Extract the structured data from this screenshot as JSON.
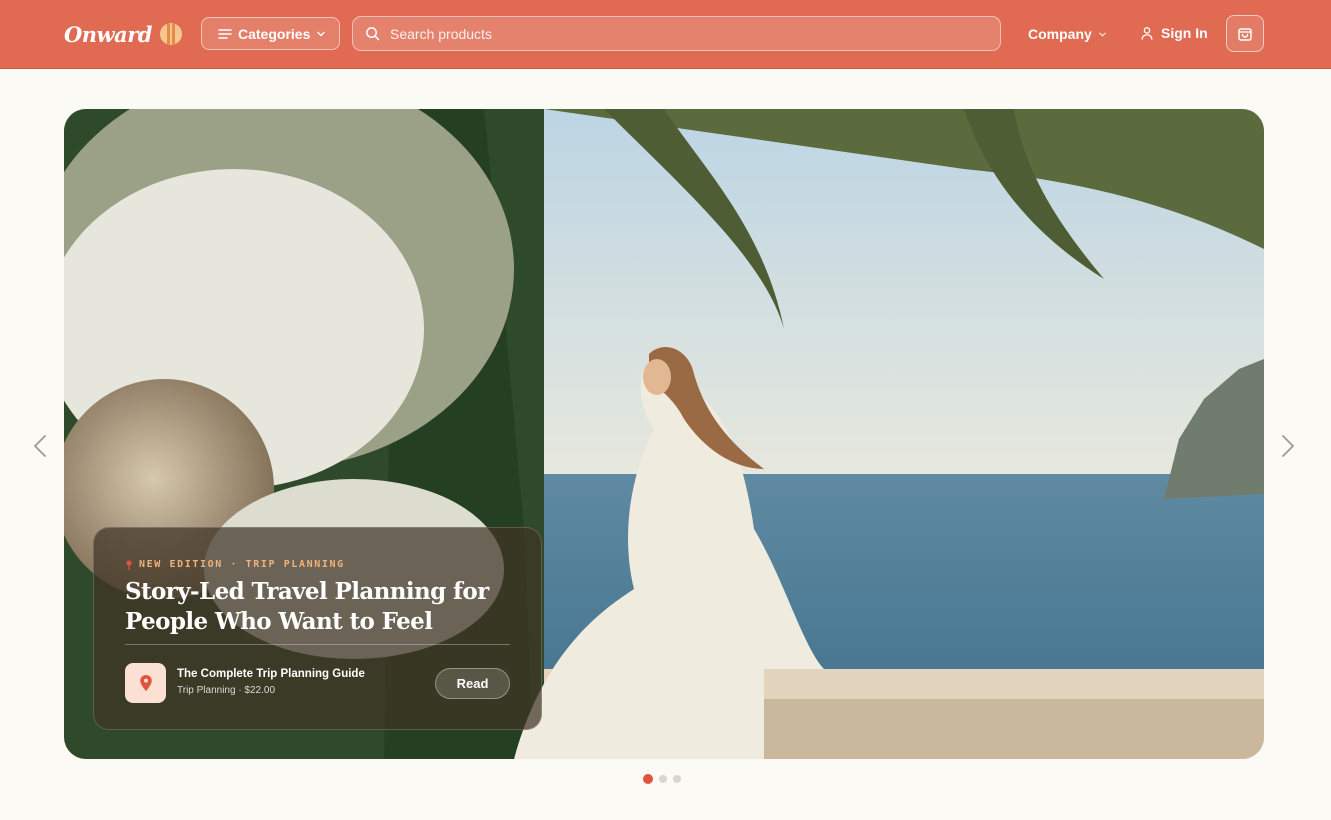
{
  "brand": {
    "name": "Onward"
  },
  "header": {
    "categories_label": "Categories",
    "search_placeholder": "Search products",
    "company_label": "Company",
    "signin_label": "Sign In"
  },
  "hero": {
    "eyebrow": "NEW EDITION · TRIP PLANNING",
    "title": "Story-Led Travel Planning for People Who Want to Feel",
    "product": {
      "name": "The Complete Trip Planning Guide",
      "meta": "Trip Planning · $22.00"
    },
    "read_label": "Read"
  },
  "carousel": {
    "slide_count": 3,
    "active_index": 0
  },
  "colors": {
    "accent": "#e06a52",
    "active_dot": "#e0533d",
    "eyebrow": "#f0b27a"
  },
  "icons": [
    "menu-icon",
    "chevron-down-icon",
    "search-icon",
    "user-icon",
    "shopping-bag-icon",
    "chevron-left-icon",
    "chevron-right-icon",
    "map-pin-icon"
  ]
}
